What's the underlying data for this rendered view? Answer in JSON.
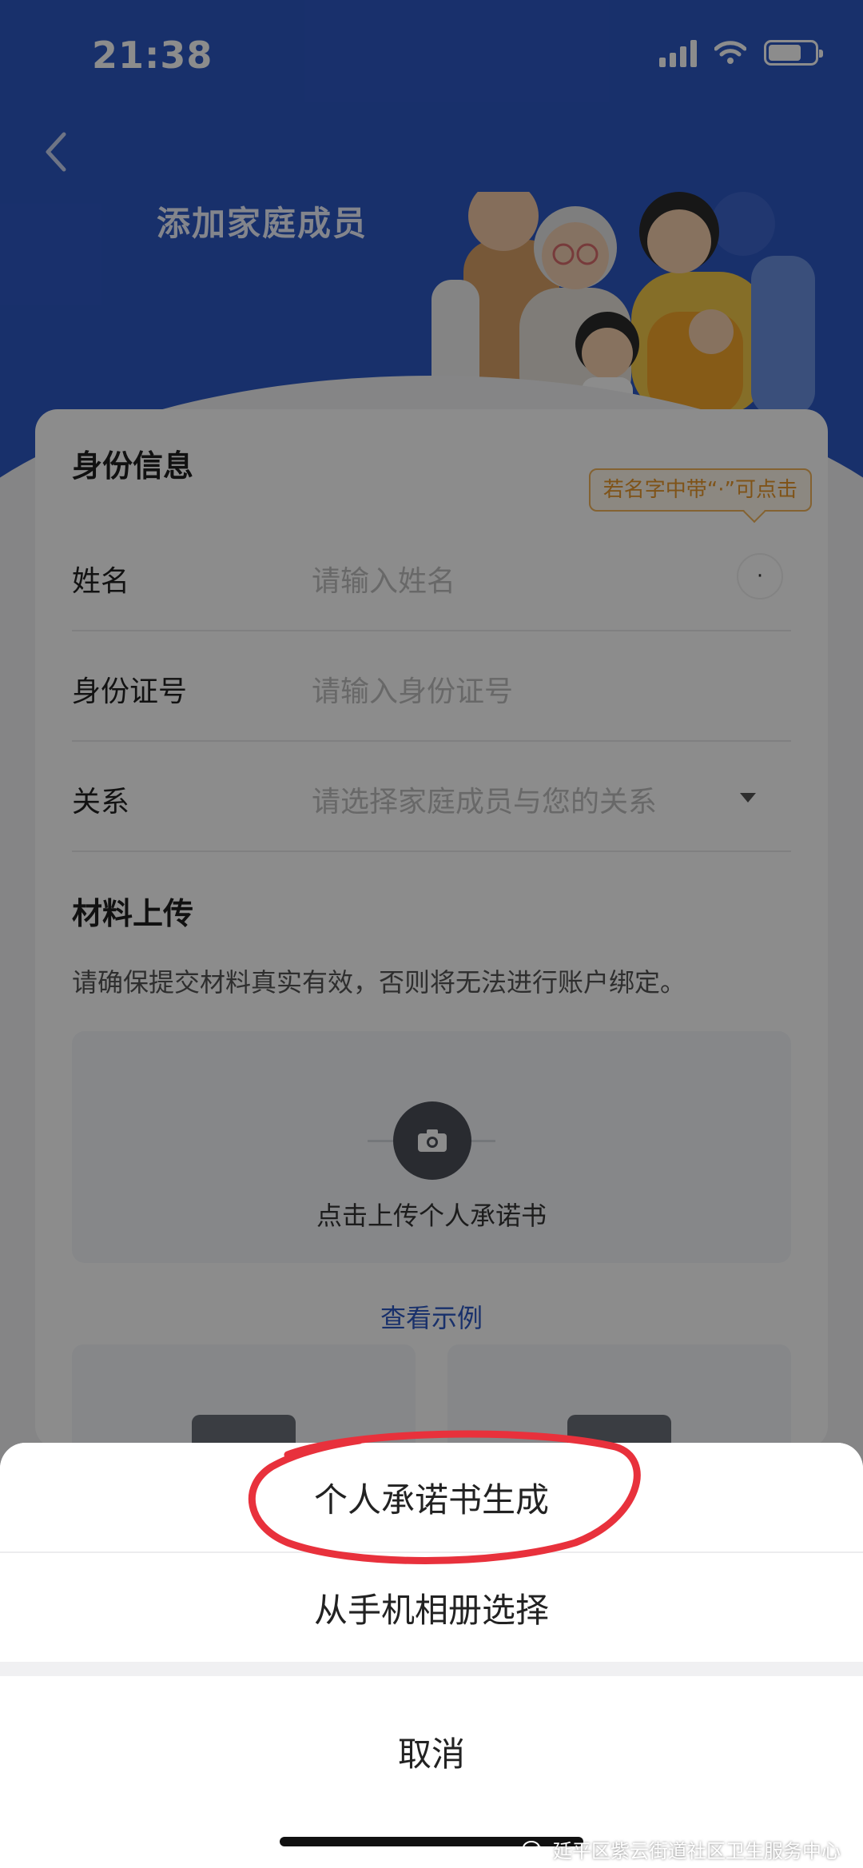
{
  "status_bar": {
    "time": "21:38"
  },
  "header": {
    "title": "添加家庭成员"
  },
  "identity": {
    "section_title": "身份信息",
    "tooltip": "若名字中带“·”可点击",
    "dot_button": "·",
    "fields": [
      {
        "label": "姓名",
        "placeholder": "请输入姓名"
      },
      {
        "label": "身份证号",
        "placeholder": "请输入身份证号"
      },
      {
        "label": "关系",
        "placeholder": "请选择家庭成员与您的关系"
      }
    ]
  },
  "materials": {
    "section_title": "材料上传",
    "note": "请确保提交材料真实有效，否则将无法进行账户绑定。",
    "upload_label": "点击上传个人承诺书",
    "example_link": "查看示例"
  },
  "action_sheet": {
    "options": [
      "个人承诺书生成",
      "从手机相册选择"
    ],
    "cancel": "取消"
  },
  "watermark": "延平区紫云街道社区卫生服务中心",
  "colors": {
    "brand_blue": "#2d58c4",
    "annotation_red": "#e8313c",
    "tooltip_orange": "#e8972d"
  }
}
